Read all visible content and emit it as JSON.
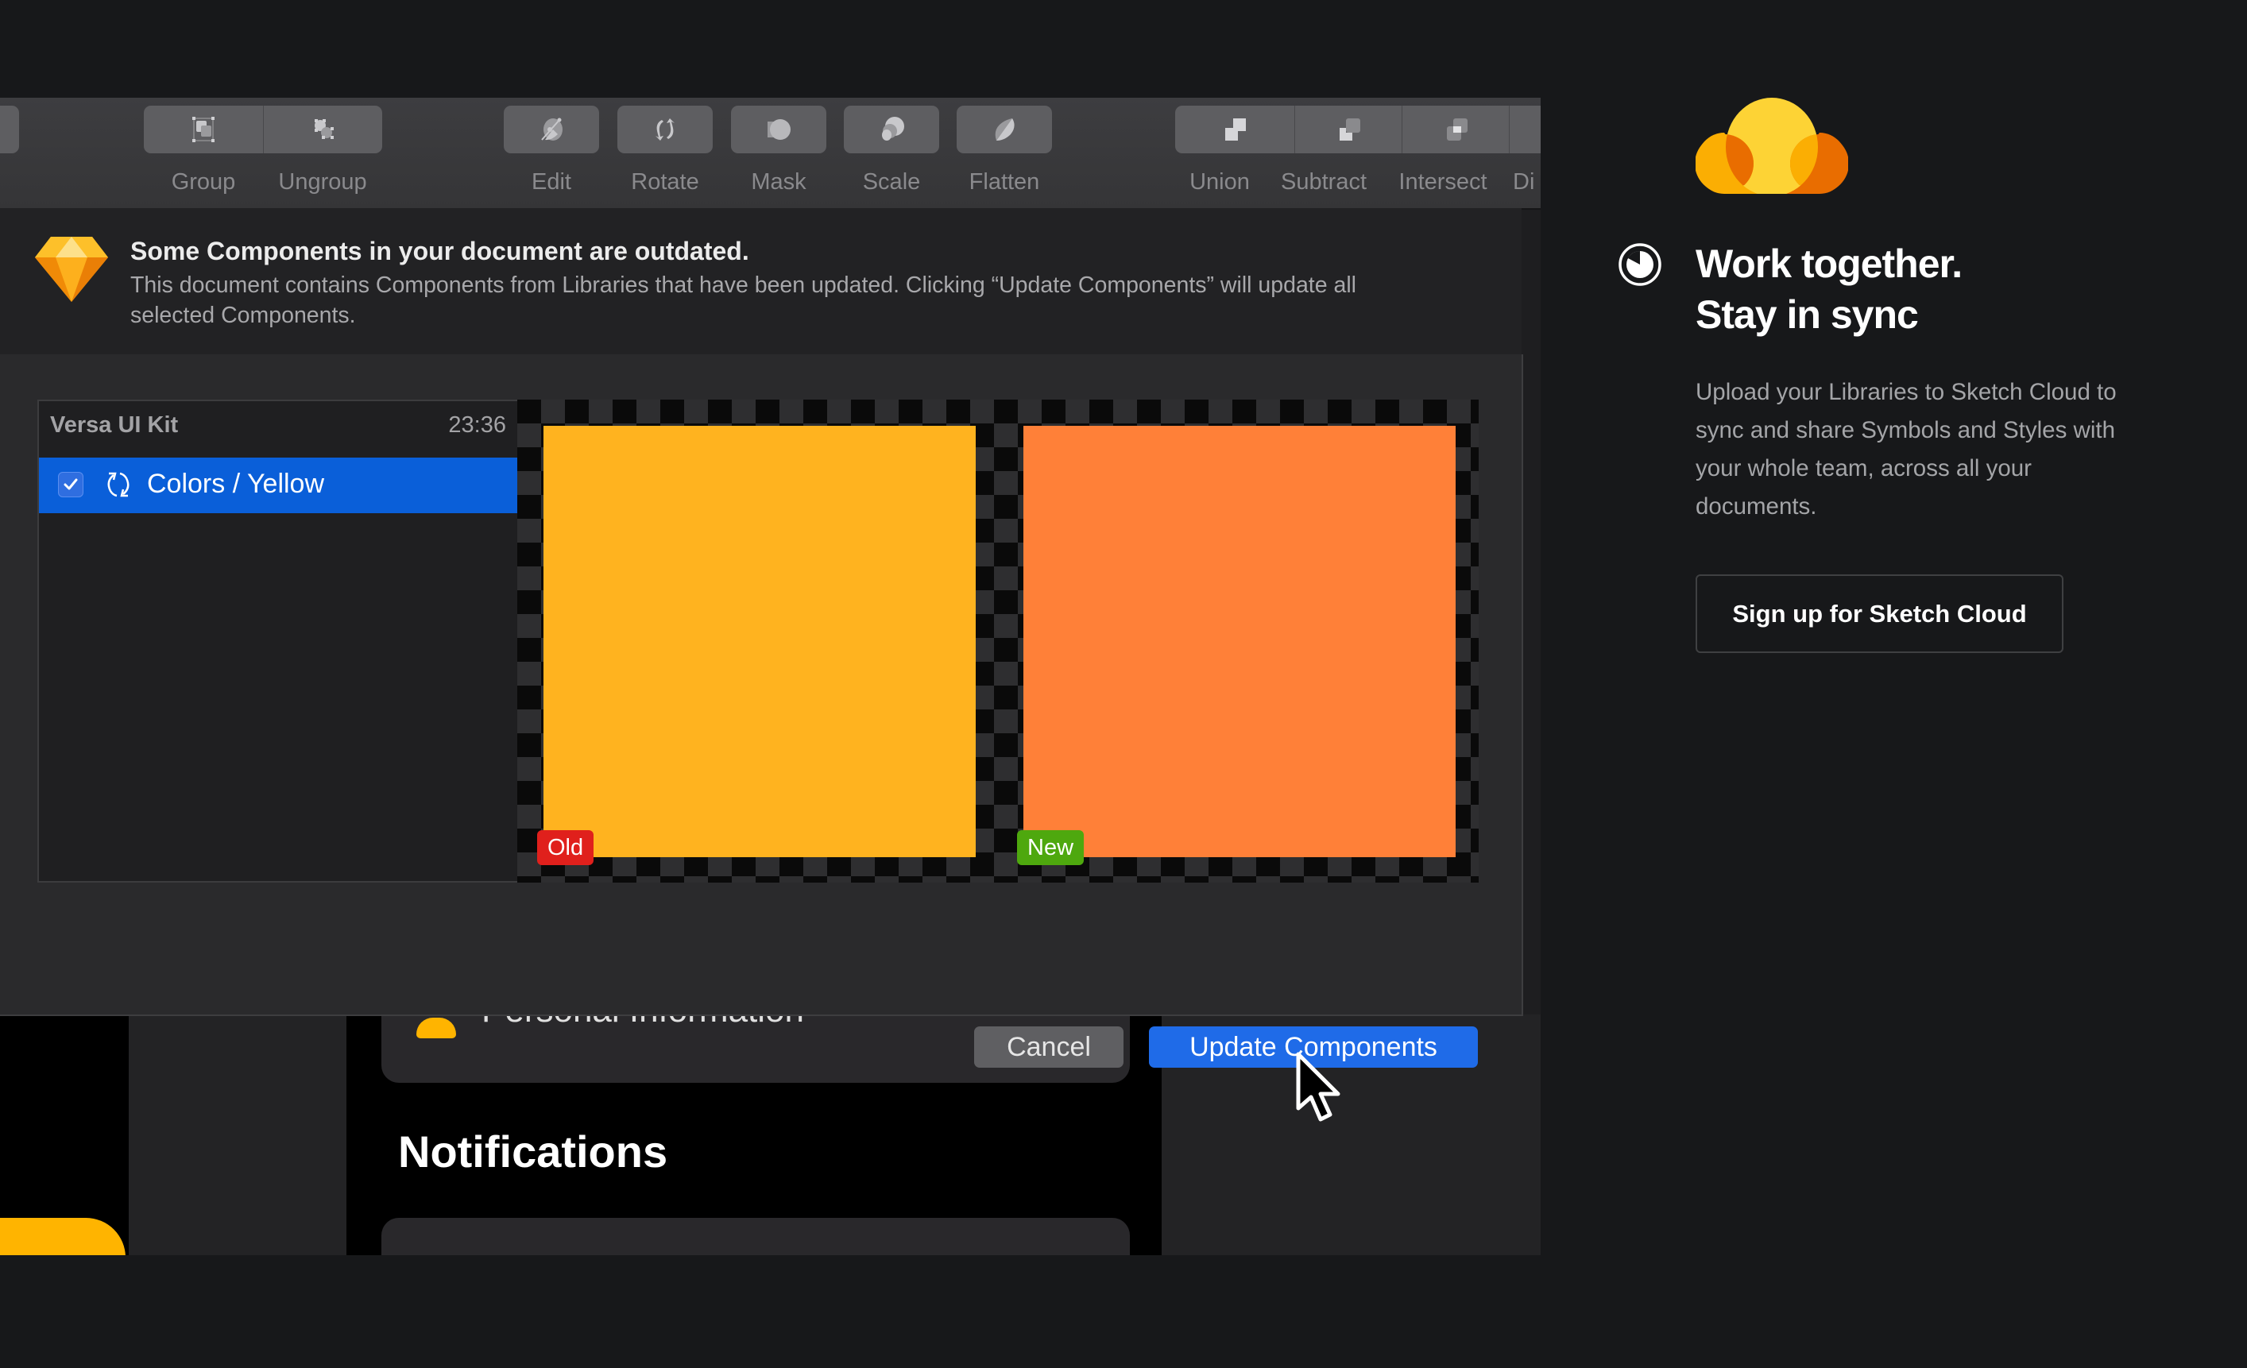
{
  "toolbar": {
    "groups": [
      {
        "items": [
          {
            "label": "Group",
            "icon": "group-icon"
          },
          {
            "label": "Ungroup",
            "icon": "ungroup-icon"
          }
        ]
      },
      {
        "items": [
          {
            "label": "Edit",
            "icon": "edit-icon"
          }
        ]
      },
      {
        "items": [
          {
            "label": "Rotate",
            "icon": "rotate-icon"
          }
        ]
      },
      {
        "items": [
          {
            "label": "Mask",
            "icon": "mask-icon"
          }
        ]
      },
      {
        "items": [
          {
            "label": "Scale",
            "icon": "scale-icon"
          }
        ]
      },
      {
        "items": [
          {
            "label": "Flatten",
            "icon": "flatten-icon"
          }
        ]
      },
      {
        "items": [
          {
            "label": "Union",
            "icon": "union-icon"
          },
          {
            "label": "Subtract",
            "icon": "subtract-icon"
          },
          {
            "label": "Intersect",
            "icon": "intersect-icon"
          },
          {
            "label": "Di",
            "icon": "difference-icon"
          }
        ]
      }
    ]
  },
  "alert": {
    "title": "Some Components in your document are outdated.",
    "body": "This document contains Components from Libraries that have been updated. Clicking “Update Components” will update all selected Components."
  },
  "list": {
    "library_name": "Versa UI Kit",
    "time": "23:36",
    "items": [
      {
        "label": "Colors / Yellow",
        "checked": true,
        "selected": true
      }
    ]
  },
  "preview": {
    "old": {
      "tag": "Old",
      "color": "#FFB31F",
      "tag_color": "#E0201C"
    },
    "new": {
      "tag": "New",
      "color": "#FF8038",
      "tag_color": "#4EA80E"
    }
  },
  "buttons": {
    "cancel": "Cancel",
    "update": "Update Components"
  },
  "underlying": {
    "row_label": "Personal Information",
    "section_title": "Notifications"
  },
  "promo": {
    "heading_line1": "Work together.",
    "heading_line2": "Stay in sync",
    "description": "Upload your Libraries to Sketch Cloud to sync and share Symbols and Styles with your whole team, across all your documents.",
    "cta": "Sign up for Sketch Cloud"
  },
  "colors": {
    "accent_blue": "#1F6BE8",
    "selection_blue": "#0A5FD9",
    "cloud_yellow": "#FDD335",
    "cloud_orange": "#FBAE03",
    "cloud_dark_orange": "#E96D00"
  }
}
